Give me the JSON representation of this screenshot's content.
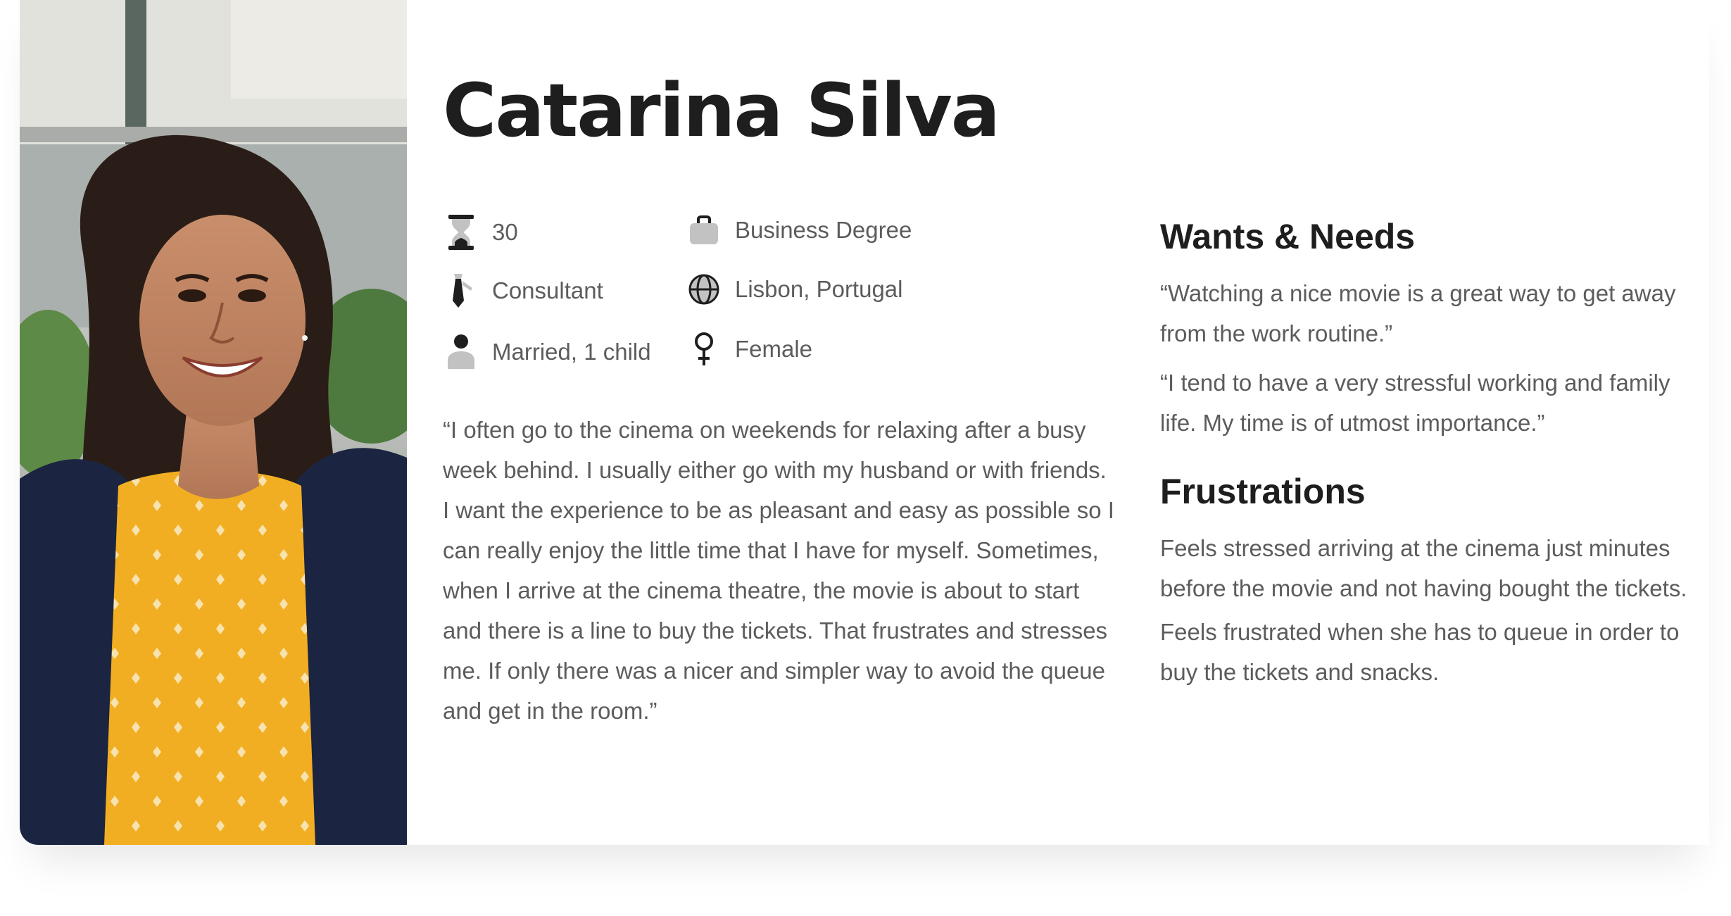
{
  "persona": {
    "name": "Catarina Silva",
    "photo_icon": "portrait-photo",
    "attributes": [
      {
        "icon": "hourglass-icon",
        "label": "30"
      },
      {
        "icon": "briefcase-icon",
        "label": "Business Degree"
      },
      {
        "icon": "tie-icon",
        "label": "Consultant"
      },
      {
        "icon": "globe-icon",
        "label": "Lisbon, Portugal"
      },
      {
        "icon": "person-icon",
        "label": "Married, 1 child"
      },
      {
        "icon": "female-icon",
        "label": "Female"
      }
    ],
    "quote": "“I often go to the cinema on weekends for relaxing after a busy week behind. I usually either go with my husband or with friends. I want the experience to be as pleasant and easy as possible so I can really enjoy the little time that I have for myself. Sometimes, when I arrive at the cinema theatre, the movie is about to start and there is a line to buy the tickets. That frustrates and stresses me. If only there was a nicer and simpler way to avoid the queue and get in the room.”"
  },
  "wants_needs": {
    "title": "Wants & Needs",
    "items": [
      "“Watching a nice movie is a great way to get away from the work routine.”",
      "“I tend to have a very stressful working and family life. My time is of utmost importance.”"
    ]
  },
  "frustrations": {
    "title": "Frustrations",
    "items": [
      "Feels stressed arriving at the cinema just minutes before the movie and not having bought the tickets.",
      "Feels frustrated when she has to queue in order to buy the tickets and snacks."
    ]
  },
  "colors": {
    "heading": "#1e1e1e",
    "body_text": "#5c5c5c",
    "icon_gray": "#c2c2c2",
    "icon_dark": "#1e1e1e"
  }
}
